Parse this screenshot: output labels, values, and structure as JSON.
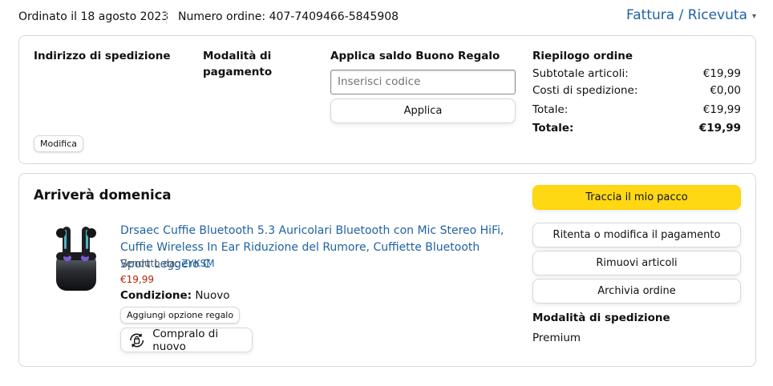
{
  "header": {
    "order_date": "Ordinato il 18 agosto 2023",
    "order_number": "Numero ordine: 407-7409466-5845908",
    "invoice_link": "Fattura / Ricevuta"
  },
  "details": {
    "shipping_address_heading": "Indirizzo di spedizione",
    "payment_method_heading_line1": "Modalità di",
    "payment_method_heading_line2": "pagamento",
    "modify_button": "Modifica",
    "gift_heading": "Applica saldo Buono Regalo",
    "gift_placeholder": "Inserisci codice",
    "apply_button": "Applica",
    "summary": {
      "heading": "Riepilogo ordine",
      "rows": [
        {
          "label": "Subtotale articoli:",
          "value": "€19,99"
        },
        {
          "label": "Costi di spedizione:",
          "value": "€0,00"
        },
        {
          "label": "Totale:",
          "value": "€19,99"
        },
        {
          "label": "Totale:",
          "value": "€19,99"
        }
      ]
    }
  },
  "shipment": {
    "arrival": "Arriverà domenica",
    "product_title": "Drsaec Cuffie Bluetooth 5.3 Auricolari Bluetooth con Mic Stereo HiFi, Cuffie Wireless In Ear Riduzione del Rumore, Cuffiette Bluetooth Sport Leggero C",
    "sold_by_label": "Venduto da:",
    "seller": "ZYKSM",
    "price": "€19,99",
    "condition_label": "Condizione:",
    "condition_value": "Nuovo",
    "gift_option_button": "Aggiungi opzione regalo",
    "buy_again_button": "Compralo di nuovo",
    "actions": {
      "track": "Traccia il mio pacco",
      "retry_payment": "Ritenta o modifica il pagamento",
      "remove_items": "Rimuovi articoli",
      "archive": "Archivia ordine"
    },
    "shipping_mode_heading": "Modalità di spedizione",
    "shipping_mode": "Premium"
  },
  "colors": {
    "link": "#2162a1",
    "price": "#b12704",
    "primary_button": "#ffd814",
    "border": "#d5d9d9"
  }
}
